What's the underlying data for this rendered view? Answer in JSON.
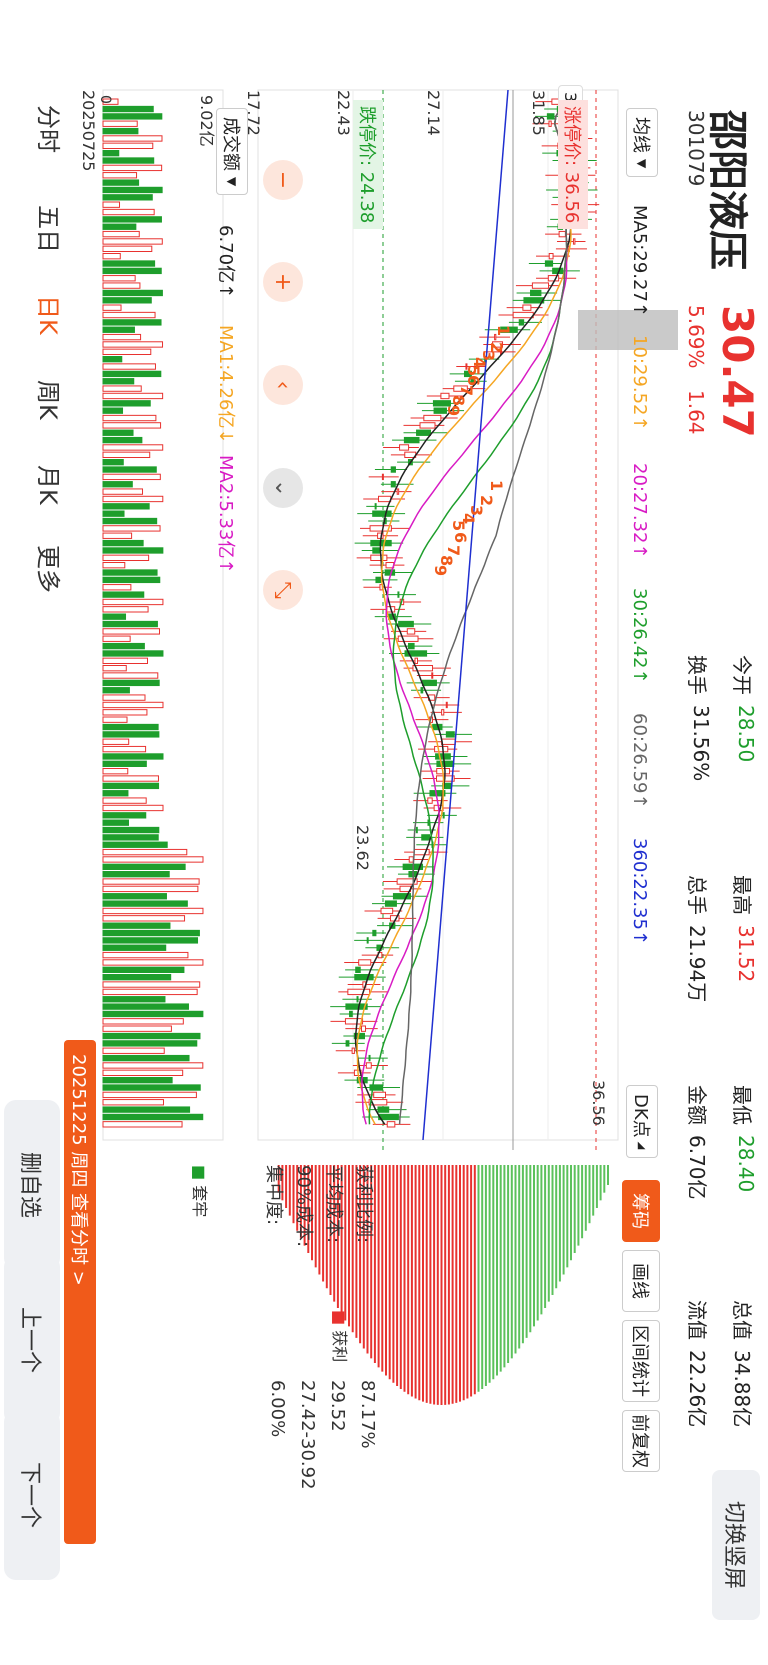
{
  "header": {
    "name": "邵阳液压",
    "code": "301079",
    "price": "30.47",
    "pct": "5.69%",
    "change": "1.64",
    "stats": [
      {
        "label": "今开",
        "value": "28.50",
        "color": "green"
      },
      {
        "label": "最高",
        "value": "31.52",
        "color": "red"
      },
      {
        "label": "最低",
        "value": "28.40",
        "color": "green"
      },
      {
        "label": "总值",
        "value": "34.88亿",
        "color": "dark"
      },
      {
        "label": "换手",
        "value": "31.56%",
        "color": "dark"
      },
      {
        "label": "总手",
        "value": "21.94万",
        "color": "dark"
      },
      {
        "label": "金额",
        "value": "6.70亿",
        "color": "dark"
      },
      {
        "label": "流值",
        "value": "22.26亿",
        "color": "dark"
      }
    ],
    "switch_label": "切换竖屏"
  },
  "ma_bar": {
    "dropdown": "均线",
    "items": [
      {
        "text": "MA5:29.27↑",
        "color": "#222222"
      },
      {
        "text": "10:29.52↑",
        "color": "#f5a623"
      },
      {
        "text": "20:27.32↑",
        "color": "#d81bc4"
      },
      {
        "text": "30:26.42↑",
        "color": "#1e9e2c"
      },
      {
        "text": "60:26.59↑",
        "color": "#666666"
      },
      {
        "text": "360:22.35↑",
        "color": "#1f2fd0"
      }
    ]
  },
  "right_tabs": {
    "dk_label": "DK点",
    "tabs": [
      "筹码",
      "画线",
      "区间统计",
      "前复权"
    ],
    "active": "筹码"
  },
  "price_chart": {
    "y_labels": [
      "31.85",
      "27.14",
      "22.43",
      "17.72"
    ],
    "current_price_tag": "30.47",
    "limit_up": "涨停价: 36.56",
    "limit_down": "跌停价: 24.38",
    "high_mark": "36.56",
    "low_mark": "23.62",
    "start_date": "20250725",
    "numbers_group1": [
      "1",
      "2",
      "3",
      "4",
      "5",
      "6",
      "7",
      "8",
      "9"
    ],
    "numbers_group2": [
      "1",
      "2",
      "3",
      "4",
      "5",
      "6",
      "7",
      "8",
      "9"
    ]
  },
  "volume": {
    "dropdown": "成交额",
    "value": "6.70亿↑",
    "ma1": "MA1:4.26亿↓",
    "ma2": "MA2:5.33亿↑",
    "max_label": "9.02亿",
    "zero_label": "0"
  },
  "chip_panel": {
    "legend_trap": "套牢",
    "legend_profit": "获利",
    "rows": [
      {
        "label": "获利比例:",
        "value": "87.17%"
      },
      {
        "label": "平均成本:",
        "value": "29.52"
      },
      {
        "label": "90%成本:",
        "value": "27.42-30.92"
      },
      {
        "label": "集中度:",
        "value": "6.00%"
      }
    ]
  },
  "date_banner": "20251225 周四 查看分时 >",
  "bottom_tabs": [
    "分时",
    "五日",
    "日K",
    "周K",
    "月K",
    "更多"
  ],
  "bottom_active": "日K",
  "side_buttons": [
    "删自选",
    "上一个",
    "下一个"
  ],
  "controls": [
    "minus-icon",
    "plus-icon",
    "left-icon",
    "down-icon",
    "shrink-icon"
  ],
  "colors": {
    "up": "#e8322f",
    "down": "#1e9e2c",
    "accent": "#f05a1a",
    "ma5": "#222222",
    "ma10": "#f5a623",
    "ma20": "#d81bc4",
    "ma30": "#1e9e2c",
    "ma60": "#666666",
    "ma360": "#1f2fd0"
  }
}
